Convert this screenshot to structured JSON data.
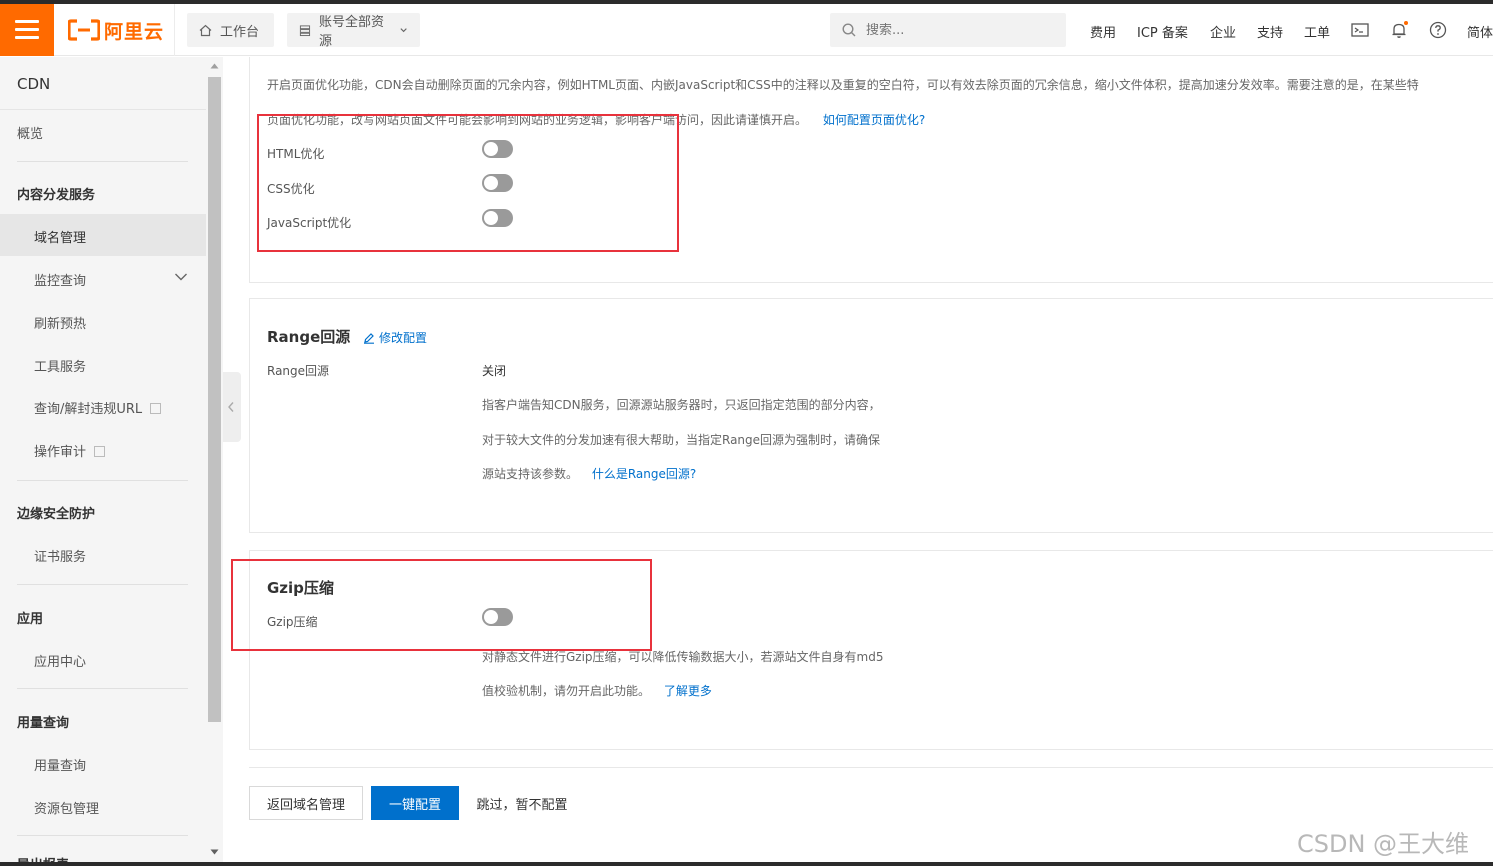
{
  "header": {
    "logo_text": "阿里云",
    "workbench": "工作台",
    "resources": "账号全部资源",
    "search_placeholder": "搜索...",
    "links": [
      "费用",
      "ICP 备案",
      "企业",
      "支持",
      "工单"
    ],
    "lang": "简体"
  },
  "sidebar": {
    "title": "CDN",
    "overview": "概览",
    "groups": {
      "content": "内容分发服务",
      "security": "边缘安全防护",
      "apps": "应用",
      "usage": "用量查询"
    },
    "items": {
      "domain": "域名管理",
      "monitor": "监控查询",
      "refresh": "刷新预热",
      "tools": "工具服务",
      "illegal_url": "查询/解封违规URL",
      "audit": "操作审计",
      "cert": "证书服务",
      "app_center": "应用中心",
      "usage_query": "用量查询",
      "package": "资源包管理",
      "cut_off": "导出报表"
    }
  },
  "page_opt": {
    "desc_line1": "开启页面优化功能，CDN会自动删除页面的冗余内容，例如HTML页面、内嵌JavaScript和CSS中的注释以及重复的空白符，可以有效去除页面的冗余信息，缩小文件体积，提高加速分发效率。需要注意的是，在某些特",
    "desc_line2": "页面优化功能，改写网站页面文件可能会影响到网站的业务逻辑，影响客户端访问，因此请谨慎开启。",
    "help_link": "如何配置页面优化?",
    "html_label": "HTML优化",
    "css_label": "CSS优化",
    "js_label": "JavaScript优化",
    "html_enabled": false,
    "css_enabled": false,
    "js_enabled": false
  },
  "range": {
    "title": "Range回源",
    "edit": "修改配置",
    "label": "Range回源",
    "value": "关闭",
    "desc1": "指客户端告知CDN服务，回源源站服务器时，只返回指定范围的部分内容，",
    "desc2": "对于较大文件的分发加速有很大帮助，当指定Range回源为强制时，请确保",
    "desc3": "源站支持该参数。",
    "link": "什么是Range回源?"
  },
  "gzip": {
    "title": "Gzip压缩",
    "label": "Gzip压缩",
    "enabled": false,
    "desc1": "对静态文件进行Gzip压缩，可以降低传输数据大小，若源站文件自身有md5",
    "desc2": "值校验机制，请勿开启此功能。",
    "link": "了解更多"
  },
  "footer": {
    "back": "返回域名管理",
    "one_click": "一键配置",
    "skip": "跳过，暂不配置"
  },
  "watermark": "CSDN @王大维",
  "colors": {
    "brand": "#ff6a00",
    "primary": "#0070cc",
    "highlight": "#e8323c"
  }
}
